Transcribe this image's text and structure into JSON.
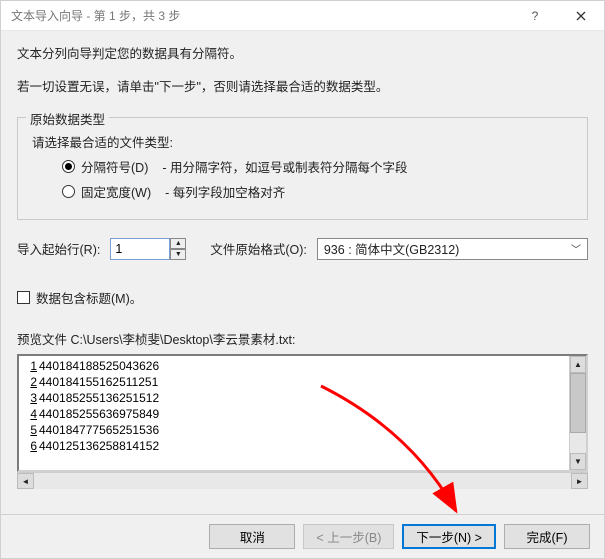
{
  "title": "文本导入向导 - 第 1 步，共 3 步",
  "line1": "文本分列向导判定您的数据具有分隔符。",
  "line2": "若一切设置无误，请单击\"下一步\"，否则请选择最合适的数据类型。",
  "group": {
    "title": "原始数据类型",
    "subtitle": "请选择最合适的文件类型:",
    "opt1_label": "分隔符号(D)",
    "opt1_desc": "- 用分隔字符，如逗号或制表符分隔每个字段",
    "opt2_label": "固定宽度(W)",
    "opt2_desc": "- 每列字段加空格对齐"
  },
  "start_row_label": "导入起始行(R):",
  "start_row_value": "1",
  "origin_label": "文件原始格式(O):",
  "origin_value": "936 : 简体中文(GB2312)",
  "headers_label": "数据包含标题(M)。",
  "preview_label": "预览文件 C:\\Users\\李桢斐\\Desktop\\李云景素材.txt:",
  "preview_lines": [
    "440184188525043626",
    "440184155162511251",
    "440185255136251512",
    "440185255636975849",
    "440184777565251536",
    "440125136258814152"
  ],
  "buttons": {
    "cancel": "取消",
    "back": "< 上一步(B)",
    "next": "下一步(N) >",
    "finish": "完成(F)"
  }
}
